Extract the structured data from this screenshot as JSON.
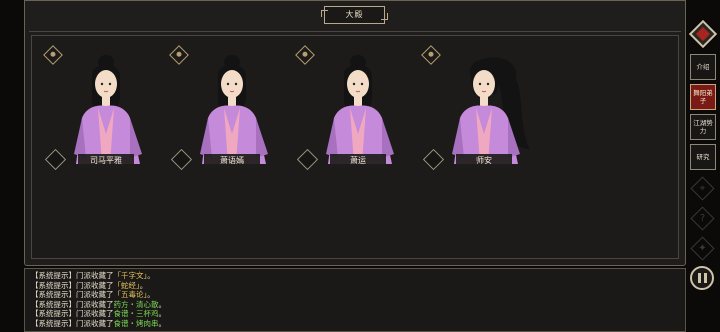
{
  "hall": {
    "title": "大殿"
  },
  "disciples": [
    {
      "name": "司马平雅",
      "hair": "pinned"
    },
    {
      "name": "萧语嫣",
      "hair": "pinned"
    },
    {
      "name": "萧运",
      "hair": "pinned"
    },
    {
      "name": "师安",
      "hair": "flowing"
    }
  ],
  "sidebar": {
    "buttons": [
      {
        "label": "介绍",
        "active": false
      },
      {
        "label": "舞阳弟子",
        "active": true
      },
      {
        "label": "江湖势力",
        "active": false
      },
      {
        "label": "研究",
        "active": false
      }
    ],
    "disabled_glyphs": [
      "⌖",
      "?",
      "✦"
    ]
  },
  "log": [
    {
      "prefix": "【系统提示】门派收藏了",
      "item": "「千字文」",
      "suffix": "。",
      "color": "#e8c55a"
    },
    {
      "prefix": "【系统提示】门派收藏了",
      "item": "「蛇经」",
      "suffix": "。",
      "color": "#e8c55a"
    },
    {
      "prefix": "【系统提示】门派收藏了",
      "item": "「五毒论」",
      "suffix": "。",
      "color": "#e8c55a"
    },
    {
      "prefix": "【系统提示】门派收藏了",
      "item": "药方・清心散",
      "suffix": "。",
      "color": "#7ed957"
    },
    {
      "prefix": "【系统提示】门派收藏了",
      "item": "食谱・三杯鸡",
      "suffix": "。",
      "color": "#7ed957"
    },
    {
      "prefix": "【系统提示】门派收藏了",
      "item": "食谱・烤肉串",
      "suffix": "。",
      "color": "#7ed957"
    }
  ],
  "colors": {
    "active_tab": "#7a1a16",
    "robe": "#c58ad9",
    "inner_robe": "#f0a8c0",
    "log_item_gold": "#e8c55a",
    "log_item_green": "#7ed957"
  }
}
